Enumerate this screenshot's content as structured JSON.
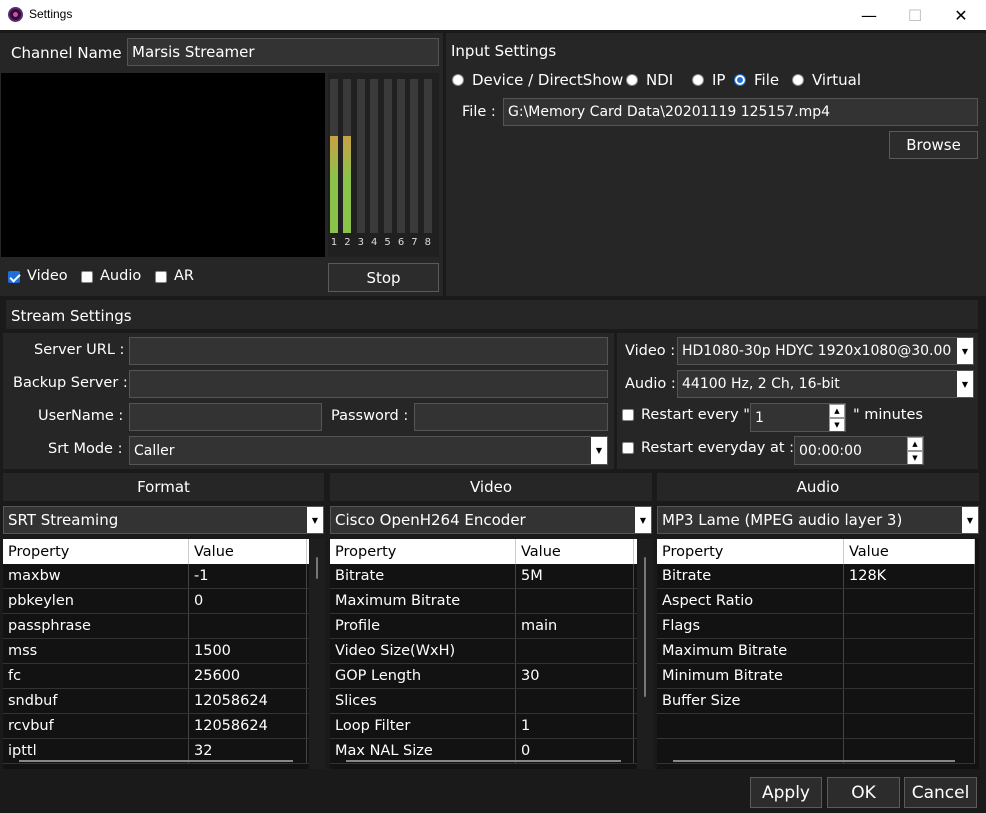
{
  "window": {
    "title": "Settings",
    "min": "—",
    "max": "☐",
    "close": "✕"
  },
  "channel": {
    "label": "Channel Name :",
    "value": "Marsis Streamer"
  },
  "meter": {
    "labels": [
      "1",
      "2",
      "3",
      "4",
      "5",
      "6",
      "7",
      "8"
    ],
    "levels": [
      0.63,
      0.63,
      0,
      0,
      0,
      0,
      0,
      0
    ]
  },
  "preview": {
    "video": {
      "label": "Video",
      "checked": true
    },
    "audio": {
      "label": "Audio",
      "checked": false
    },
    "ar": {
      "label": "AR",
      "checked": false
    },
    "stop": "Stop"
  },
  "input": {
    "title": "Input Settings",
    "sources": [
      {
        "label": "Device / DirectShow",
        "selected": false
      },
      {
        "label": "NDI",
        "selected": false
      },
      {
        "label": "IP",
        "selected": false
      },
      {
        "label": "File",
        "selected": true
      },
      {
        "label": "Virtual",
        "selected": false
      }
    ],
    "file_label": "File :",
    "file_value": "G:\\Memory Card Data\\20201119 125157.mp4",
    "browse": "Browse"
  },
  "stream": {
    "title": "Stream Settings",
    "server_url_label": "Server URL :",
    "server_url": "",
    "backup_label": "Backup Server :",
    "backup": "",
    "username_label": "UserName :",
    "username": "",
    "password_label": "Password :",
    "password": "",
    "srt_label": "Srt Mode :",
    "srt_value": "Caller",
    "video_label": "Video :",
    "video_value": "HD1080-30p HDYC 1920x1080@30.00",
    "audio_label": "Audio :",
    "audio_value": "44100 Hz, 2 Ch, 16-bit",
    "restart_every_label": "Restart every \"",
    "restart_every_value": "1",
    "restart_every_unit": "\" minutes",
    "restart_daily_label": "Restart everyday at :",
    "restart_daily_value": "00:00:00"
  },
  "format": {
    "title": "Format",
    "selected": "SRT Streaming",
    "col_property": "Property",
    "col_value": "Value",
    "rows": [
      [
        "maxbw",
        "-1"
      ],
      [
        "pbkeylen",
        "0"
      ],
      [
        "passphrase",
        ""
      ],
      [
        "mss",
        "1500"
      ],
      [
        "fc",
        "25600"
      ],
      [
        "sndbuf",
        "12058624"
      ],
      [
        "rcvbuf",
        "12058624"
      ],
      [
        "ipttl",
        "32"
      ]
    ]
  },
  "video": {
    "title": "Video",
    "selected": "Cisco OpenH264 Encoder",
    "col_property": "Property",
    "col_value": "Value",
    "rows": [
      [
        "Bitrate",
        "5M"
      ],
      [
        "Maximum Bitrate",
        ""
      ],
      [
        "Profile",
        "main"
      ],
      [
        "Video Size(WxH)",
        ""
      ],
      [
        "GOP Length",
        "30"
      ],
      [
        "Slices",
        ""
      ],
      [
        "Loop Filter",
        "1"
      ],
      [
        "Max NAL Size",
        "0"
      ]
    ]
  },
  "audio": {
    "title": "Audio",
    "selected": "MP3 Lame (MPEG audio layer 3)",
    "col_property": "Property",
    "col_value": "Value",
    "rows": [
      [
        "Bitrate",
        "128K"
      ],
      [
        "Aspect Ratio",
        ""
      ],
      [
        "Flags",
        ""
      ],
      [
        "Maximum Bitrate",
        ""
      ],
      [
        "Minimum Bitrate",
        ""
      ],
      [
        "Buffer Size",
        ""
      ],
      [
        "",
        ""
      ],
      [
        "",
        ""
      ]
    ]
  },
  "footer": {
    "apply": "Apply",
    "ok": "OK",
    "cancel": "Cancel"
  },
  "colors": {
    "accent": "#1f6fd6",
    "meter_low": "#8bc34a",
    "meter_high": "#c8a046"
  }
}
